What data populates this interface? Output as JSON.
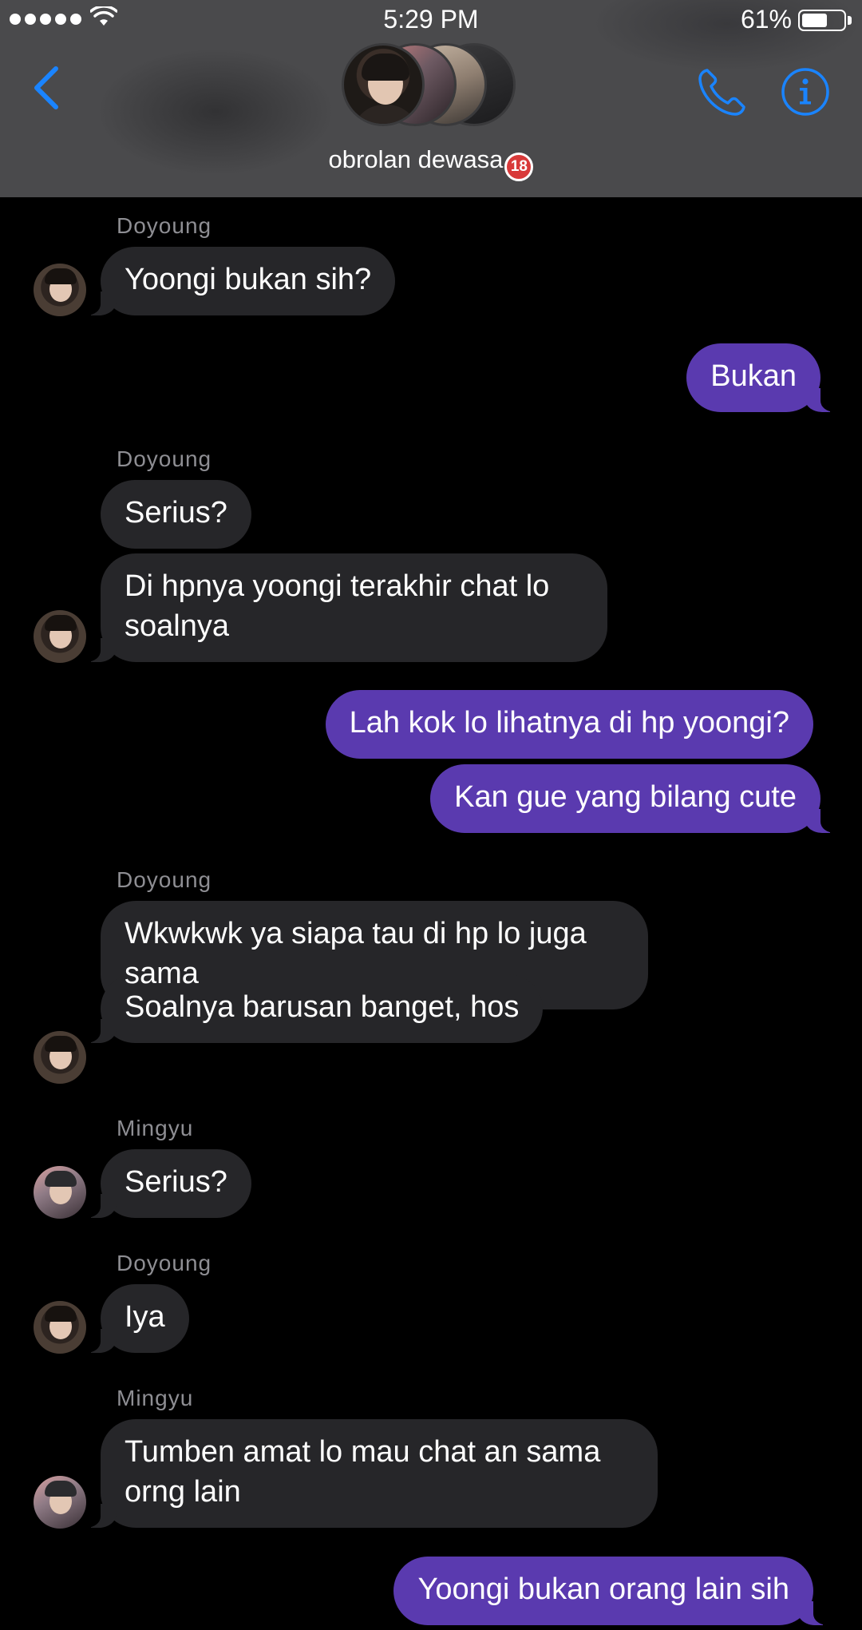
{
  "status_bar": {
    "time": "5:29 PM",
    "battery_percent": "61%",
    "battery_level": 0.61,
    "signal_bars": 5
  },
  "header": {
    "group_name": "obrolan dewasa",
    "badge": "18",
    "back_icon": "chevron-left-icon",
    "call_icon": "phone-icon",
    "info_icon": "info-icon",
    "accent_color": "#1a84ff"
  },
  "colors": {
    "header_bg": "#4a4a4c",
    "incoming_bubble": "#262629",
    "outgoing_bubble": "#5a3aaf",
    "sender_name": "#8e8e93"
  },
  "messages": [
    {
      "sender": "Doyoung",
      "direction": "in",
      "text": "Yoongi bukan sih?"
    },
    {
      "direction": "out",
      "text": "Bukan"
    },
    {
      "sender": "Doyoung",
      "direction": "in",
      "text": "Serius?"
    },
    {
      "direction": "in",
      "text": "Di hpnya yoongi terakhir chat lo soalnya"
    },
    {
      "direction": "out",
      "text": "Lah kok lo lihatnya di hp yoongi?"
    },
    {
      "direction": "out",
      "text": "Kan gue yang bilang cute"
    },
    {
      "sender": "Doyoung",
      "direction": "in",
      "text": "Wkwkwk ya siapa tau di hp lo juga sama"
    },
    {
      "direction": "in",
      "text": "Soalnya barusan banget, hos"
    },
    {
      "sender": "Mingyu",
      "direction": "in",
      "text": "Serius?"
    },
    {
      "sender": "Doyoung",
      "direction": "in",
      "text": "Iya"
    },
    {
      "sender": "Mingyu",
      "direction": "in",
      "text": "Tumben amat lo mau chat an sama orng lain"
    },
    {
      "direction": "out",
      "text": "Yoongi bukan orang lain sih"
    }
  ]
}
